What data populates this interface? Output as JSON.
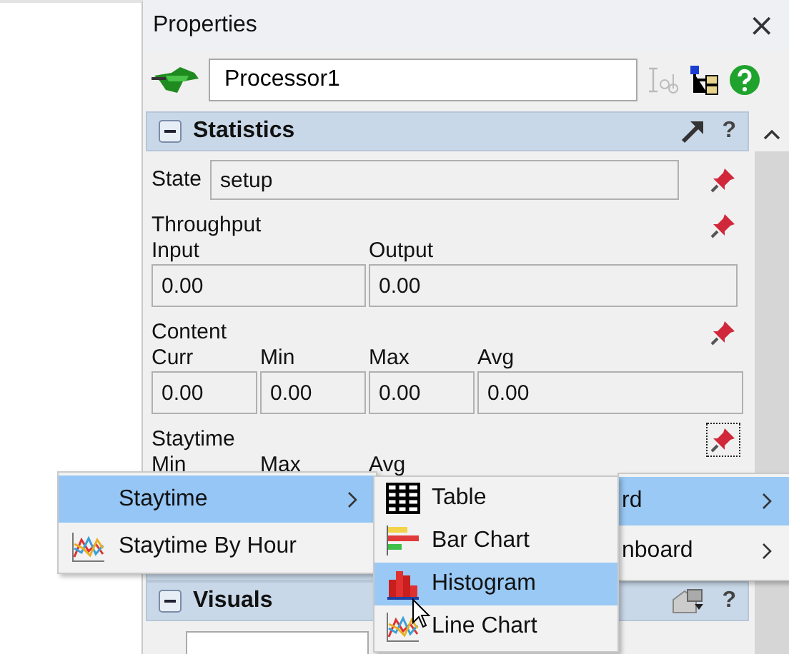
{
  "panel": {
    "title": "Properties",
    "close": "×"
  },
  "object": {
    "name": "Processor1"
  },
  "statistics": {
    "title": "Statistics",
    "expanded": true,
    "help": "?",
    "state": {
      "label": "State",
      "value": "setup"
    },
    "throughput": {
      "label": "Throughput",
      "fields": [
        {
          "label": "Input",
          "value": "0.00"
        },
        {
          "label": "Output",
          "value": "0.00"
        }
      ]
    },
    "content": {
      "label": "Content",
      "fields": [
        {
          "label": "Curr",
          "value": "0.00"
        },
        {
          "label": "Min",
          "value": "0.00"
        },
        {
          "label": "Max",
          "value": "0.00"
        },
        {
          "label": "Avg",
          "value": "0.00"
        }
      ]
    },
    "staytime": {
      "label": "Staytime",
      "fields": [
        {
          "label": "Min"
        },
        {
          "label": "Max"
        },
        {
          "label": "Avg"
        }
      ]
    }
  },
  "visuals": {
    "title": "Visuals",
    "expanded": true,
    "help": "?"
  },
  "back_menu": {
    "items": [
      {
        "label": "rd",
        "selected": true,
        "submenu": true
      },
      {
        "label": "nboard",
        "selected": false,
        "submenu": true
      }
    ]
  },
  "menu": {
    "items": [
      {
        "label": "Staytime",
        "kind": "plain",
        "selected": true,
        "submenu": true
      },
      {
        "label": "Staytime By Hour",
        "kind": "line-chart",
        "selected": false,
        "submenu": false
      }
    ]
  },
  "submenu": {
    "items": [
      {
        "label": "Table",
        "kind": "table",
        "selected": false
      },
      {
        "label": "Bar Chart",
        "kind": "bar-chart",
        "selected": false
      },
      {
        "label": "Histogram",
        "kind": "histogram",
        "selected": true
      },
      {
        "label": "Line Chart",
        "kind": "line-chart",
        "selected": false
      }
    ]
  }
}
